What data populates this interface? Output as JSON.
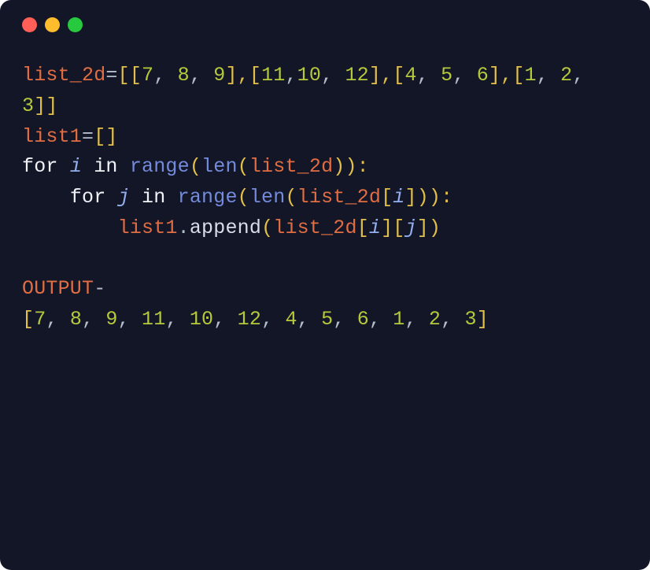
{
  "titlebar": {
    "buttons": [
      "close",
      "minimize",
      "zoom"
    ]
  },
  "code": {
    "line1": {
      "ident": "list_2d",
      "eq": "=",
      "open1": "[[",
      "n1": "7",
      "c1": ", ",
      "n2": "8",
      "c2": ", ",
      "n3": "9",
      "close1": "],[",
      "n4": "11",
      "c3": ",",
      "n5": "10",
      "c4": ", ",
      "n6": "12",
      "close2": "],[",
      "n7": "4",
      "c5": ", ",
      "n8": "5",
      "c6": ", ",
      "n9": "6",
      "close3": "],[",
      "n10": "1",
      "c7": ", ",
      "n11": "2",
      "c8": ", ",
      "n12": "3",
      "close4": "]]"
    },
    "line2": {
      "ident": "list1",
      "eq": "=",
      "brackets": "[]"
    },
    "line3": {
      "for": "for",
      "sp1": " ",
      "i": "i",
      "sp2": " ",
      "in": "in",
      "sp3": " ",
      "range": "range",
      "open": "(",
      "len": "len",
      "open2": "(",
      "ident": "list_2d",
      "close": ")):"
    },
    "line4": {
      "indent": "    ",
      "for": "for",
      "sp1": " ",
      "j": "j",
      "sp2": " ",
      "in": "in",
      "sp3": " ",
      "range": "range",
      "open": "(",
      "len": "len",
      "open2": "(",
      "ident": "list_2d",
      "bracket_open": "[",
      "i": "i",
      "bracket_close": "])):"
    },
    "line5": {
      "indent": "        ",
      "ident": "list1",
      "dot": ".",
      "method": "append",
      "open": "(",
      "ident2": "list_2d",
      "bracket1": "[",
      "i": "i",
      "bracket2": "][",
      "j": "j",
      "bracket3": "])"
    },
    "blank": " ",
    "line7": {
      "label": "OUTPUT",
      "dash": "-"
    },
    "line8": {
      "open": "[",
      "n1": "7",
      "c1": ", ",
      "n2": "8",
      "c2": ", ",
      "n3": "9",
      "c3": ", ",
      "n4": "11",
      "c4": ", ",
      "n5": "10",
      "c5": ", ",
      "n6": "12",
      "c6": ", ",
      "n7": "4",
      "c7": ", ",
      "n8": "5",
      "c8": ", ",
      "n9": "6",
      "c9": ", ",
      "n10": "1",
      "c10": ", ",
      "n11": "2",
      "c11": ", ",
      "n12": "3",
      "close": "]"
    }
  }
}
